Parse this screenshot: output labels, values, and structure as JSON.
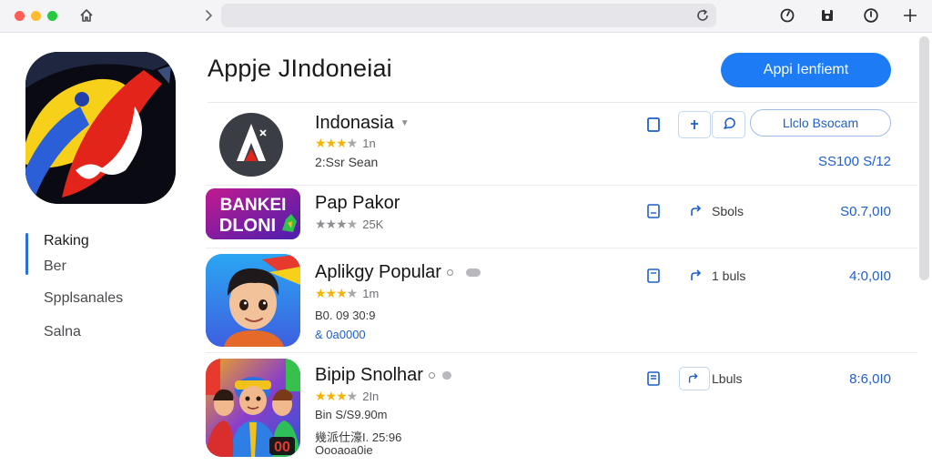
{
  "titlebar": {
    "icons": [
      "home-icon",
      "forward-icon",
      "reload-icon",
      "speed-icon",
      "save-icon",
      "info-icon",
      "plus-icon"
    ]
  },
  "sidebar": {
    "hero_icon": "app-hero-logo",
    "items": [
      {
        "label": "Raking",
        "selected": true
      },
      {
        "label": "Ber",
        "selected": false
      },
      {
        "label": "Spplsanales",
        "selected": false
      },
      {
        "label": "Salna",
        "selected": false
      }
    ]
  },
  "header": {
    "title": "Appje JIndoneiai",
    "primary_button": "Appi Ienfiemt"
  },
  "apps": [
    {
      "name": "Indonasia",
      "stars": 4,
      "rating_count": "1n",
      "meta1": "2:Ssr Sean",
      "action_button": "Llclo Bsocam",
      "price": "SS100 S/12",
      "icon": "a-logo-icon"
    },
    {
      "name": "Pap Pakor",
      "stars": 3,
      "rating_count": "25K",
      "action_label": "Sbols",
      "price": "S0.7,0I0",
      "icon": "banner-game-icon",
      "icon_text": [
        "BANKEI",
        "DLONI"
      ]
    },
    {
      "name": "Aplikgy Popular",
      "stars": 4,
      "rating_count": "1m",
      "meta1": "B0. 09 30:9",
      "meta2": "& 0a0000",
      "action_label": "1 buls",
      "price": "4:0,0I0",
      "icon": "cartoon-boy-icon"
    },
    {
      "name": "Bipip Snolhar",
      "stars": 4,
      "rating_count": "2In",
      "meta1": "Bin S/S9.90m",
      "meta2": "幾派仕濠I. 25:96",
      "meta3": "Oooaoa0ie",
      "action_label": "Lbuls",
      "price": "8:6,0I0",
      "icon": "cartoon-group-icon",
      "icon_text": "00"
    }
  ],
  "colors": {
    "accent": "#1d7bf5",
    "link": "#1f5fc9",
    "star": "#f5b400",
    "selected_indicator": "#2b6fd8"
  }
}
